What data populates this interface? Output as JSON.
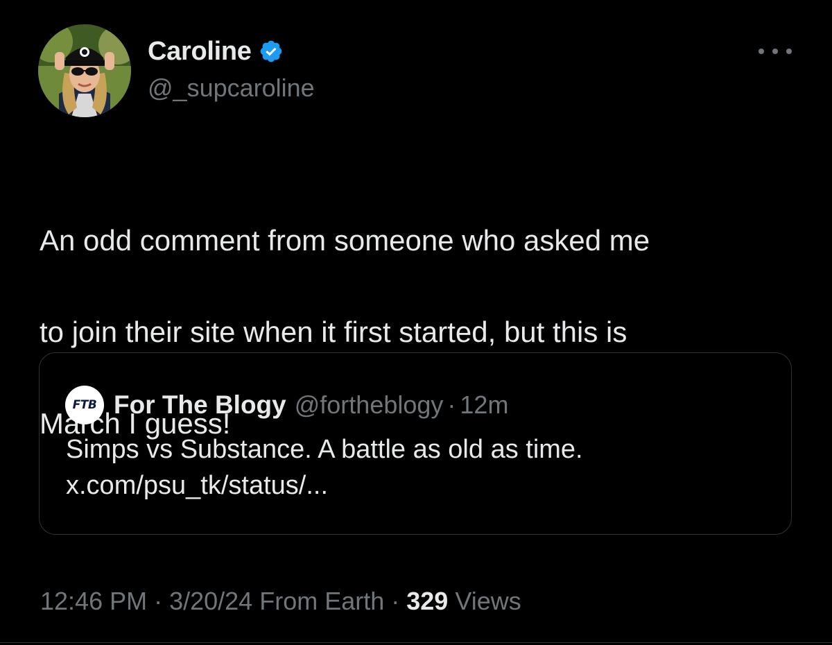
{
  "author": {
    "display_name": "Caroline",
    "handle": "@_supcaroline",
    "verified": true,
    "verified_color": "#1d9bf0",
    "avatar_icon": "profile-photo"
  },
  "more_icon": "more-horizontal-icon",
  "tweet": {
    "text_lines": [
      "An odd comment from someone who asked me",
      "to join their site when it first started, but this is",
      "March I guess!"
    ]
  },
  "quoted_tweet": {
    "logo_text": "FTB",
    "display_name": "For The Blogy",
    "handle": "@fortheblogy",
    "separator": "·",
    "time": "12m",
    "text_line_1": "Simps vs Substance. A battle as old as time.",
    "text_line_2": "x.com/psu_tk/status/..."
  },
  "meta": {
    "time": "12:46 PM",
    "sep1": " · ",
    "date": "3/20/24",
    "location": " From Earth",
    "sep2": " · ",
    "views_count": "329",
    "views_label": " Views"
  },
  "colors": {
    "background": "#000000",
    "primary_text": "#e7e9ea",
    "secondary_text": "#71767b",
    "border": "#2f3336"
  }
}
